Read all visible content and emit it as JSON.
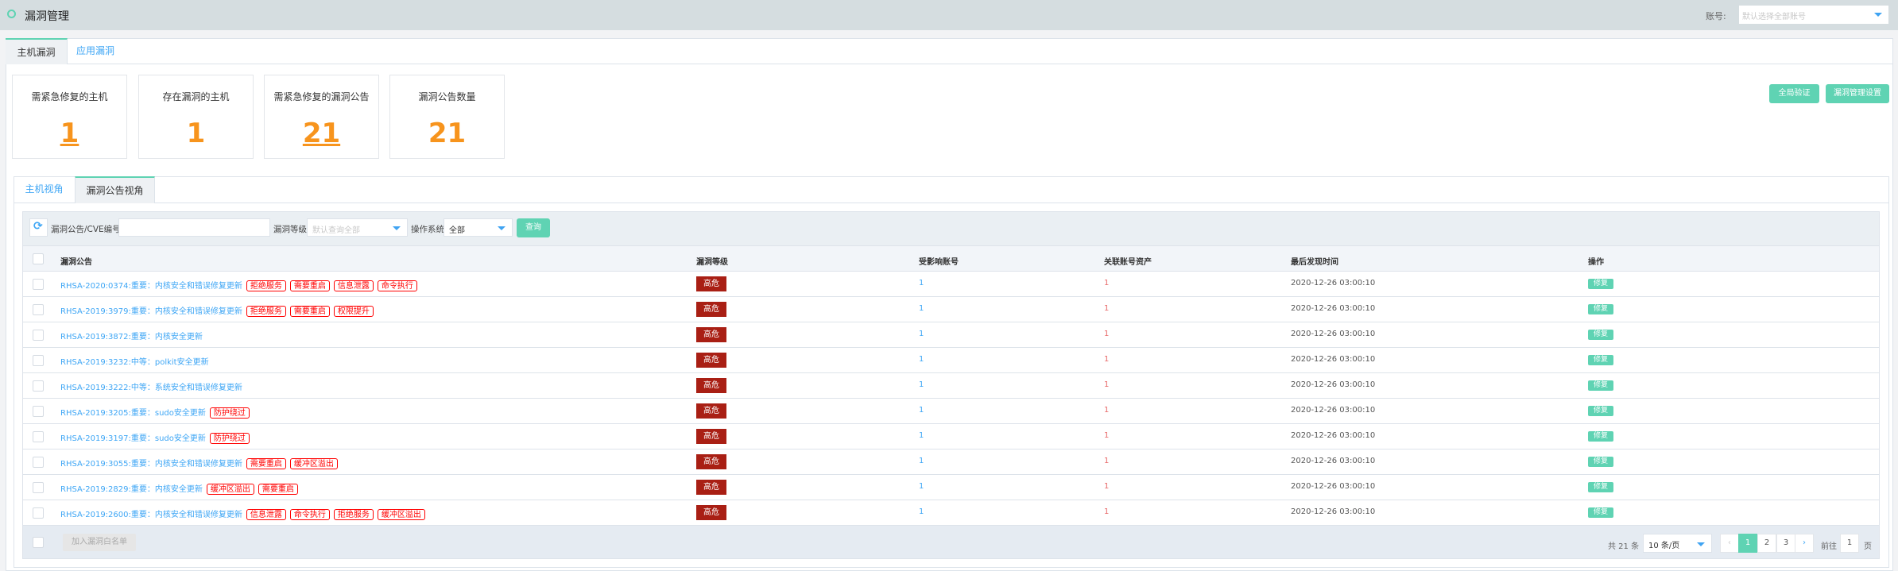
{
  "header": {
    "title": "漏洞管理",
    "account_label": "账号:",
    "account_placeholder": "默认选择全部账号"
  },
  "tabs": [
    "主机漏洞",
    "应用漏洞"
  ],
  "cards": [
    {
      "label": "需紧急修复的主机",
      "value": "1"
    },
    {
      "label": "存在漏洞的主机",
      "value": "1"
    },
    {
      "label": "需紧急修复的漏洞公告",
      "value": "21"
    },
    {
      "label": "漏洞公告数量",
      "value": "21"
    }
  ],
  "actions": {
    "verify": "全局验证",
    "settings": "漏洞管理设置"
  },
  "inner_tabs": [
    "主机视角",
    "漏洞公告视角"
  ],
  "filter": {
    "cve_label": "漏洞公告/CVE编号",
    "cve_value": "",
    "level_label": "漏洞等级",
    "level_placeholder": "默认查询全部",
    "os_label": "操作系统",
    "os_value": "全部",
    "query": "查询"
  },
  "columns": [
    "漏洞公告",
    "漏洞等级",
    "受影响账号",
    "关联账号资产",
    "最后发现时间",
    "操作"
  ],
  "rows": [
    {
      "title": "RHSA-2020:0374:重要：内核安全和错误修复更新",
      "tags": [
        "拒绝服务",
        "需要重启",
        "信息泄露",
        "命令执行"
      ],
      "level": "高危",
      "accounts": "1",
      "assets": "1",
      "time": "2020-12-26 03:00:10",
      "action": "修复"
    },
    {
      "title": "RHSA-2019:3979:重要：内核安全和错误修复更新",
      "tags": [
        "拒绝服务",
        "需要重启",
        "权限提升"
      ],
      "level": "高危",
      "accounts": "1",
      "assets": "1",
      "time": "2020-12-26 03:00:10",
      "action": "修复"
    },
    {
      "title": "RHSA-2019:3872:重要：内核安全更新",
      "tags": [],
      "level": "高危",
      "accounts": "1",
      "assets": "1",
      "time": "2020-12-26 03:00:10",
      "action": "修复"
    },
    {
      "title": "RHSA-2019:3232:中等：polkit安全更新",
      "tags": [],
      "level": "高危",
      "accounts": "1",
      "assets": "1",
      "time": "2020-12-26 03:00:10",
      "action": "修复"
    },
    {
      "title": "RHSA-2019:3222:中等：系统安全和错误修复更新",
      "tags": [],
      "level": "高危",
      "accounts": "1",
      "assets": "1",
      "time": "2020-12-26 03:00:10",
      "action": "修复"
    },
    {
      "title": "RHSA-2019:3205:重要：sudo安全更新",
      "tags": [
        "防护绕过"
      ],
      "level": "高危",
      "accounts": "1",
      "assets": "1",
      "time": "2020-12-26 03:00:10",
      "action": "修复"
    },
    {
      "title": "RHSA-2019:3197:重要：sudo安全更新",
      "tags": [
        "防护绕过"
      ],
      "level": "高危",
      "accounts": "1",
      "assets": "1",
      "time": "2020-12-26 03:00:10",
      "action": "修复"
    },
    {
      "title": "RHSA-2019:3055:重要：内核安全和错误修复更新",
      "tags": [
        "需要重启",
        "缓冲区溢出"
      ],
      "level": "高危",
      "accounts": "1",
      "assets": "1",
      "time": "2020-12-26 03:00:10",
      "action": "修复"
    },
    {
      "title": "RHSA-2019:2829:重要：内核安全更新",
      "tags": [
        "缓冲区溢出",
        "需要重启"
      ],
      "level": "高危",
      "accounts": "1",
      "assets": "1",
      "time": "2020-12-26 03:00:10",
      "action": "修复"
    },
    {
      "title": "RHSA-2019:2600:重要：内核安全和错误修复更新",
      "tags": [
        "信息泄露",
        "命令执行",
        "拒绝服务",
        "缓冲区溢出"
      ],
      "level": "高危",
      "accounts": "1",
      "assets": "1",
      "time": "2020-12-26 03:00:10",
      "action": "修复"
    }
  ],
  "footer": {
    "whitelist": "加入漏洞白名单",
    "total": "共 21 条",
    "page_size": "10 条/页",
    "pages": [
      "1",
      "2",
      "3"
    ],
    "current_page": "1",
    "goto_label": "前往",
    "goto_value": "1",
    "page_suffix": "页"
  },
  "colors": {
    "accent": "#5fd3b3",
    "link": "#3ea6f5",
    "danger": "#a91f14",
    "number": "#f7941d",
    "tag": "#ff0000"
  }
}
